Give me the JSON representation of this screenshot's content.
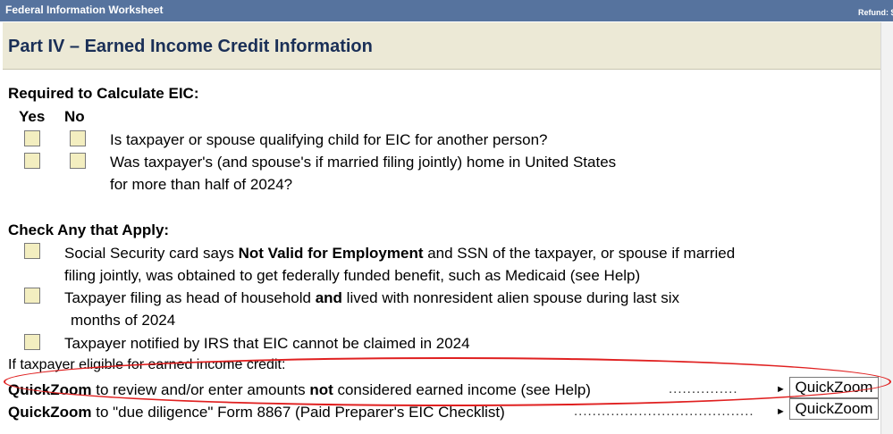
{
  "window": {
    "title": "Federal Information Worksheet",
    "refund_label": "Refund: $"
  },
  "part": {
    "title": "Part IV – Earned Income Credit Information"
  },
  "required": {
    "heading": "Required to Calculate EIC:",
    "col_yes": "Yes",
    "col_no": "No",
    "q1": "Is taxpayer or spouse qualifying child for EIC for another person?",
    "q2_line1": "Was taxpayer's (and spouse's if married filing jointly) home in United States",
    "q2_line2": "for more than half of 2024?"
  },
  "check_any": {
    "heading": "Check Any that Apply:",
    "item1_a": "Social Security card says ",
    "item1_b": "Not Valid for Employment",
    "item1_c": " and SSN of the taxpayer, or spouse if married",
    "item1_line2": "filing jointly, was obtained to get federally funded benefit, such as Medicaid (see Help)",
    "item2_a": "Taxpayer filing as head of household ",
    "item2_b": "and",
    "item2_c": " lived with nonresident alien spouse during last six",
    "item2_line2": "months of 2024",
    "item3": "Taxpayer notified by IRS that EIC cannot be claimed in 2024"
  },
  "eligible_label": "If taxpayer eligible for earned income credit:",
  "quickzoom": {
    "row1_bold": "QuickZoom",
    "row1_a": " to review and/or enter amounts ",
    "row1_b": "not",
    "row1_c": " considered earned income (see Help)",
    "row2_bold": "QuickZoom",
    "row2_text": " to  \"due diligence\" Form 8867 (Paid Preparer's EIC Checklist)",
    "button_label": "QuickZoom",
    "arrow": "►",
    "dots1": "...............",
    "dots2": "......................................."
  },
  "colors": {
    "titlebar": "#56739e",
    "part_header_bg": "#ece9d6",
    "checkbox_fill": "#f3eec0",
    "annotation": "#e02020"
  }
}
